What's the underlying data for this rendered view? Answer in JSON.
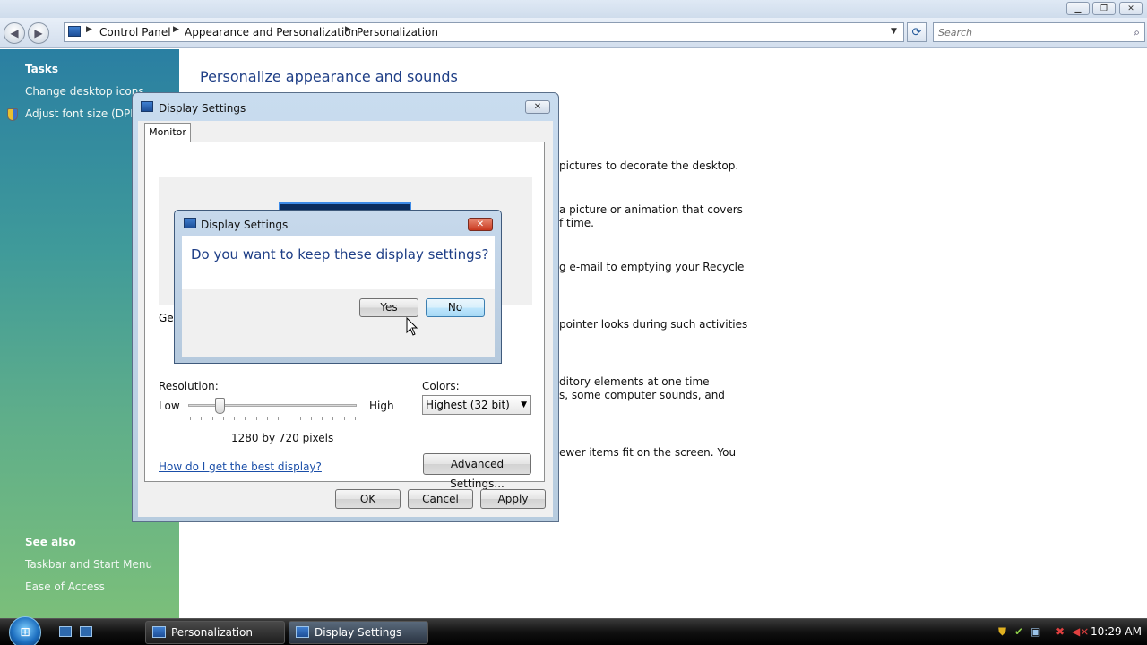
{
  "explorer": {
    "breadcrumbs": [
      "Control Panel",
      "Appearance and Personalization",
      "Personalization"
    ],
    "search_placeholder": "Search",
    "page_title": "Personalize appearance and sounds"
  },
  "left_pane": {
    "tasks_heading": "Tasks",
    "tasks": [
      "Change desktop icons",
      "Adjust font size (DPI)"
    ],
    "see_also_heading": "See also",
    "see_also": [
      "Taskbar and Start Menu",
      "Ease of Access"
    ]
  },
  "background_text": {
    "line1": "pictures to decorate the desktop.",
    "line2a": "a picture or animation that covers",
    "line2b": "f time.",
    "line3": "g e-mail to emptying your Recycle",
    "line4": "pointer looks during such activities",
    "line5a": "ditory elements at one time",
    "line5b": "s, some computer sounds, and",
    "line6": "ewer items fit on the screen. You"
  },
  "display_settings": {
    "title": "Display Settings",
    "tab": "Monitor",
    "partial_label": "Ger",
    "resolution_label": "Resolution:",
    "low": "Low",
    "high": "High",
    "resolution_value": "1280 by 720 pixels",
    "slider_level_fraction": 0.18,
    "colors_label": "Colors:",
    "colors_value": "Highest (32 bit)",
    "help_link": "How do I get the best display?",
    "advanced_button": "Advanced Settings...",
    "ok_button": "OK",
    "cancel_button": "Cancel",
    "apply_button": "Apply"
  },
  "confirm_dialog": {
    "title": "Display Settings",
    "question": "Do you want to keep these display settings?",
    "yes_button": "Yes",
    "no_button": "No"
  },
  "taskbar": {
    "buttons": [
      "Personalization",
      "Display Settings"
    ],
    "clock": "10:29 AM"
  },
  "icons": {
    "back": "back-arrow-icon",
    "forward": "forward-arrow-icon",
    "refresh": "refresh-icon",
    "search": "search-icon",
    "shield": "shield-icon",
    "start": "windows-start-icon"
  }
}
